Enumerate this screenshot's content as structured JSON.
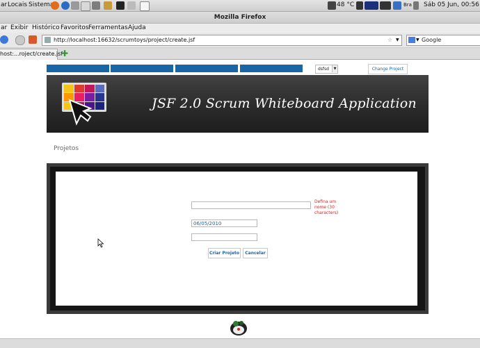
{
  "system_panel": {
    "menus": [
      "Locais",
      "Sistema"
    ],
    "temperature": "48 °C",
    "keyboard": "Bra",
    "datetime": "Sáb 05 Jun, 00:56"
  },
  "window": {
    "title": "Mozilla Firefox"
  },
  "menubar": [
    "ar",
    "Exibir",
    "Histórico",
    "Favoritos",
    "Ferramentas",
    "Ajuda"
  ],
  "navbar": {
    "url": "http://localhost:16632/scrumtoys/project/create.jsf",
    "search_placeholder": "Google"
  },
  "tab": {
    "label": "host:...roject/create.jsf"
  },
  "page": {
    "project_select": "dsfsd",
    "change_project": "Change Project",
    "banner_title": "JSF 2.0 Scrum Whiteboard Application",
    "section_title": "Projetos",
    "form": {
      "name_value": "",
      "name_error": "Defina um nome (30 characters)",
      "date_value": "06/05/2010",
      "third_value": "",
      "create_button": "Criar Projeto",
      "cancel_button": "Cancelar"
    }
  },
  "colors": {
    "accent": "#1866a5",
    "error": "#e02020",
    "banner": "#2b2b2b"
  }
}
